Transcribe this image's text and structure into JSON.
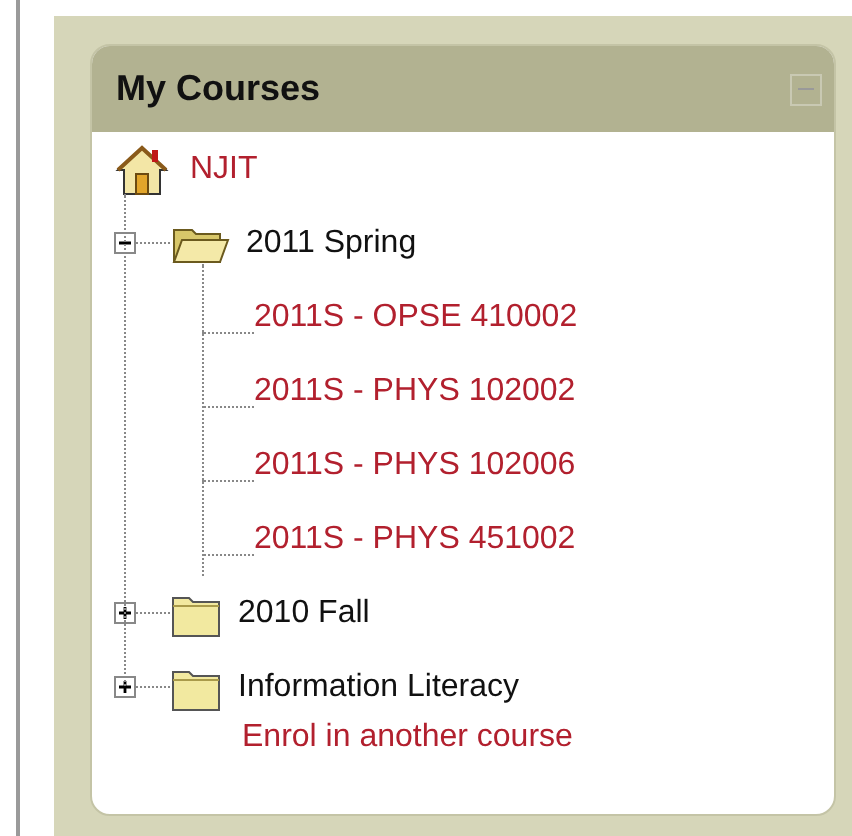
{
  "block": {
    "title": "My Courses"
  },
  "tree": [
    {
      "kind": "site",
      "label": "NJIT"
    },
    {
      "kind": "category",
      "label": "2011 Spring",
      "expanded": true,
      "children": [
        {
          "kind": "course",
          "label": "2011S - OPSE 410002"
        },
        {
          "kind": "course",
          "label": "2011S - PHYS 102002"
        },
        {
          "kind": "course",
          "label": "2011S - PHYS 102006"
        },
        {
          "kind": "course",
          "label": "2011S - PHYS 451002"
        }
      ]
    },
    {
      "kind": "category",
      "label": "2010 Fall",
      "expanded": false
    },
    {
      "kind": "category",
      "label": "Information Literacy",
      "expanded": false
    }
  ],
  "footer_link": "Enrol in another course"
}
